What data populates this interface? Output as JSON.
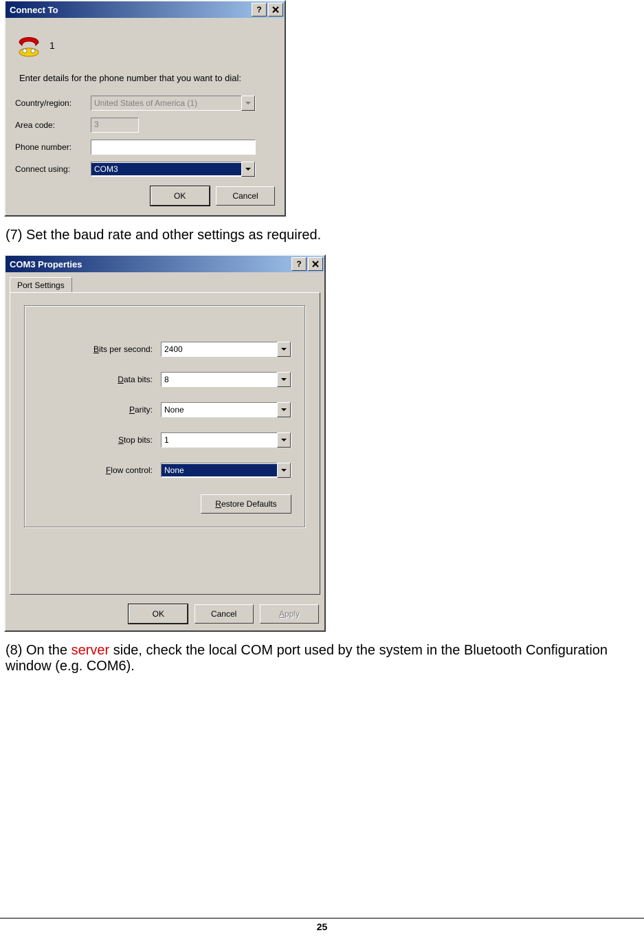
{
  "connect": {
    "title": "Connect To",
    "help_symbol": "?",
    "icon_label": "1",
    "instruction": "Enter details for the phone number that you want to dial:",
    "country_label": "Country/region:",
    "country_value": "United States of America (1)",
    "area_label": "Area code:",
    "area_value": "3",
    "phone_label": "Phone number:",
    "phone_value": "",
    "using_label": "Connect using:",
    "using_value": "COM3",
    "ok": "OK",
    "cancel": "Cancel"
  },
  "step7": "(7) Set the baud rate and other settings as required.",
  "props": {
    "title": "COM3 Properties",
    "help_symbol": "?",
    "tab": "Port Settings",
    "bits_label": "Bits per second:",
    "bits_value": "2400",
    "data_label": "Data bits:",
    "data_value": "8",
    "parity_label": "Parity:",
    "parity_value": "None",
    "stop_label": "Stop bits:",
    "stop_value": "1",
    "flow_label": "Flow control:",
    "flow_value": "None",
    "restore": "Restore Defaults",
    "ok": "OK",
    "cancel": "Cancel",
    "apply": "Apply"
  },
  "step8_pre": "(8) On the ",
  "step8_red": "server",
  "step8_post": " side, check the local COM port used by the system in the Bluetooth Configuration window (e.g. COM6).",
  "page_number": "25"
}
